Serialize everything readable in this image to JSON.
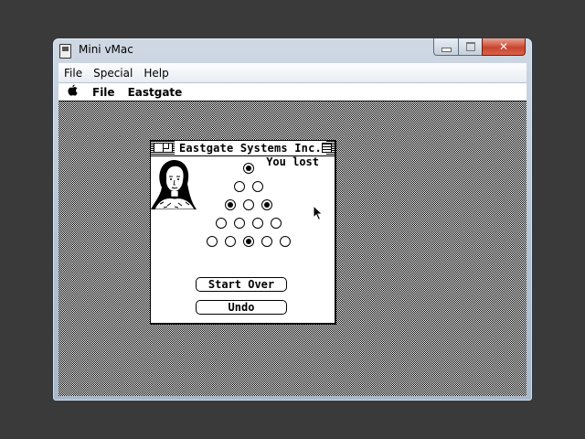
{
  "host": {
    "title": "Mini vMac",
    "menu": [
      "File",
      "Special",
      "Help"
    ],
    "buttons": {
      "minimize": "minimize",
      "maximize": "maximize",
      "close": "✕"
    }
  },
  "mac": {
    "menubar": {
      "apple": "",
      "items": [
        "File",
        "Eastgate"
      ]
    },
    "window": {
      "title": "Eastgate Systems Inc.",
      "status": "You lost",
      "buttons": {
        "start_over": "Start Over",
        "undo": "Undo"
      },
      "board": {
        "rows": [
          [
            true
          ],
          [
            false,
            false
          ],
          [
            true,
            false,
            true
          ],
          [
            false,
            false,
            false,
            false
          ],
          [
            false,
            false,
            true,
            false,
            false
          ]
        ]
      }
    }
  },
  "icons": [
    "apple-icon",
    "window-close-box-icon",
    "window-zoom-box-icon",
    "portrait-image",
    "arrow-cursor-icon"
  ]
}
